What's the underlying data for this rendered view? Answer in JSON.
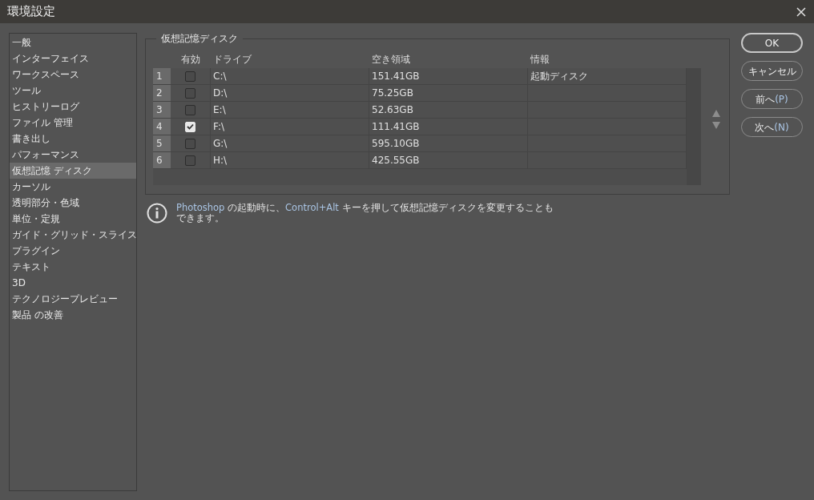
{
  "window": {
    "title": "環境設定"
  },
  "sidebar": {
    "items": [
      {
        "label": "一般",
        "selected": false
      },
      {
        "label": "インターフェイス",
        "selected": false
      },
      {
        "label": "ワークスペース",
        "selected": false
      },
      {
        "label": "ツール",
        "selected": false
      },
      {
        "label": "ヒストリーログ",
        "selected": false
      },
      {
        "label": "ファイル 管理",
        "selected": false
      },
      {
        "label": "書き出し",
        "selected": false
      },
      {
        "label": "パフォーマンス",
        "selected": false
      },
      {
        "label": "仮想記憶 ディスク",
        "selected": true
      },
      {
        "label": "カーソル",
        "selected": false
      },
      {
        "label": "透明部分・色域",
        "selected": false
      },
      {
        "label": "単位・定規",
        "selected": false
      },
      {
        "label": "ガイド・グリッド・スライス",
        "selected": false
      },
      {
        "label": "プラグイン",
        "selected": false
      },
      {
        "label": "テキスト",
        "selected": false
      },
      {
        "label": "3D",
        "selected": false
      },
      {
        "label": "テクノロジープレビュー",
        "selected": false
      },
      {
        "label": "製品 の改善",
        "selected": false
      }
    ]
  },
  "scratch_disks": {
    "title": "仮想記憶ディスク",
    "table": {
      "columns": [
        "有効",
        "ドライブ",
        "空き領域",
        "情報"
      ],
      "rows": [
        {
          "index": "1",
          "checked": false,
          "drive": "C:\\",
          "free": "151.41GB",
          "info": "起動ディスク"
        },
        {
          "index": "2",
          "checked": false,
          "drive": "D:\\",
          "free": "75.25GB"
        },
        {
          "index": "3",
          "checked": false,
          "drive": "E:\\",
          "free": "52.63GB"
        },
        {
          "index": "4",
          "checked": true,
          "drive": "F:\\",
          "free": "111.41GB"
        },
        {
          "index": "5",
          "checked": false,
          "drive": "G:\\",
          "free": "595.10GB"
        },
        {
          "index": "6",
          "checked": false,
          "drive": "H:\\",
          "free": "425.55GB"
        }
      ]
    }
  },
  "info_note": "**Photoshop** の起動時に、**Control+Alt** キーを押して仮想記憶ディスクを変更することもできます。",
  "buttons": [
    {
      "label": "OK",
      "kind": "default"
    },
    {
      "label": "キャンセル",
      "kind": "normal"
    },
    {
      "label": "前へ",
      "mnemonic": "(P)",
      "kind": "normal"
    },
    {
      "label": "次へ",
      "mnemonic": "(N)",
      "kind": "normal"
    }
  ]
}
